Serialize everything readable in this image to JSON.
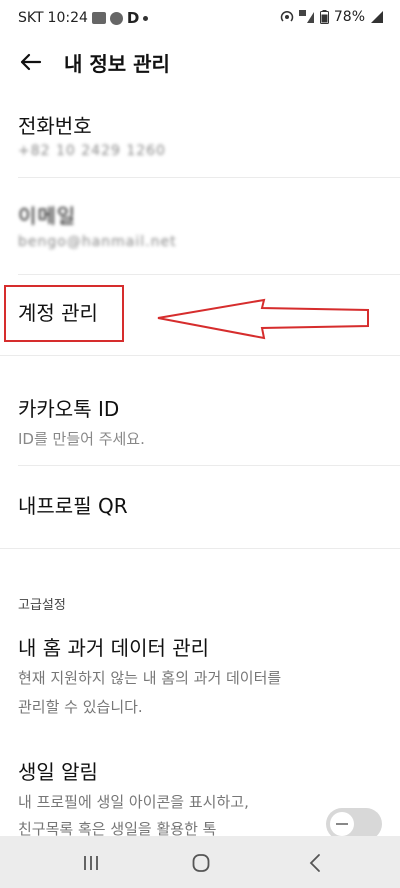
{
  "status_bar": {
    "carrier": "SKT",
    "time": "10:24",
    "d_icon": "D",
    "battery": "78%"
  },
  "header": {
    "title": "내 정보 관리"
  },
  "items": {
    "phone": {
      "title": "전화번호",
      "value": "+82 10 2429 1260"
    },
    "email": {
      "title": "이메일",
      "value": "bengo@hanmail.net"
    },
    "account": {
      "title": "계정 관리"
    },
    "kakao_id": {
      "title": "카카오톡 ID",
      "subtitle": "ID를 만들어 주세요."
    },
    "profile_qr": {
      "title": "내프로필 QR"
    }
  },
  "advanced": {
    "label": "고급설정",
    "home_data": {
      "title": "내 홈 과거 데이터 관리",
      "desc_line1": "현재 지원하지 않는 내 홈의 과거 데이터를",
      "desc_line2": "관리할 수 있습니다."
    },
    "birthday": {
      "title": "생일 알림",
      "desc_line1": "내 프로필에 생일 아이콘을 표시하고,",
      "desc_line2": "친구목록 혹은 생일을 활용한 톡",
      "enabled": false
    }
  },
  "colors": {
    "annotation_red": "#d62d2d",
    "text_primary": "#111111",
    "text_secondary": "#888888"
  }
}
